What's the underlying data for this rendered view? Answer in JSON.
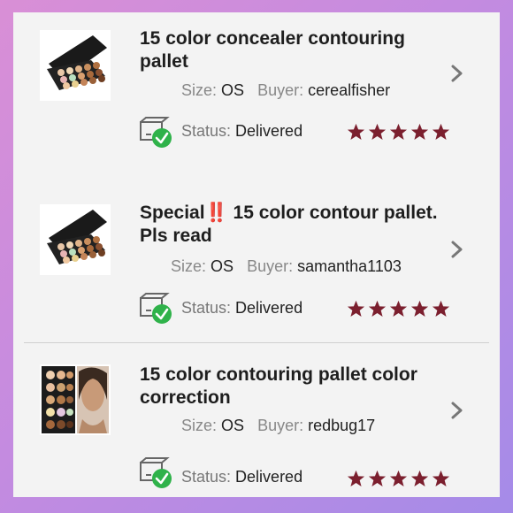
{
  "items": [
    {
      "title": "15 color concealer contouring pallet",
      "size_label": "Size:",
      "size_value": "OS",
      "buyer_label": "Buyer:",
      "buyer_value": "cerealfisher",
      "status_label": "Status:",
      "status_value": "Delivered",
      "rating": 5
    },
    {
      "title_pre": "Special",
      "title_emphasis": "‼️",
      "title_post": " 15 color contour pallet. Pls read",
      "size_label": "Size:",
      "size_value": "OS",
      "buyer_label": "Buyer:",
      "buyer_value": "samantha1103",
      "status_label": "Status:",
      "status_value": "Delivered",
      "rating": 5
    },
    {
      "title": "15 color contouring pallet color correction",
      "size_label": "Size:",
      "size_value": "OS",
      "buyer_label": "Buyer:",
      "buyer_value": "redbug17",
      "status_label": "Status:",
      "status_value": "Delivered",
      "rating": 5
    }
  ],
  "colors": {
    "star": "#7b1f2e",
    "check": "#2fb24a",
    "text": "#1e1e1e",
    "label": "#888888"
  },
  "icons": {
    "chevron": "chevron-right-icon",
    "status": "delivered-box-icon",
    "star": "star-icon"
  }
}
